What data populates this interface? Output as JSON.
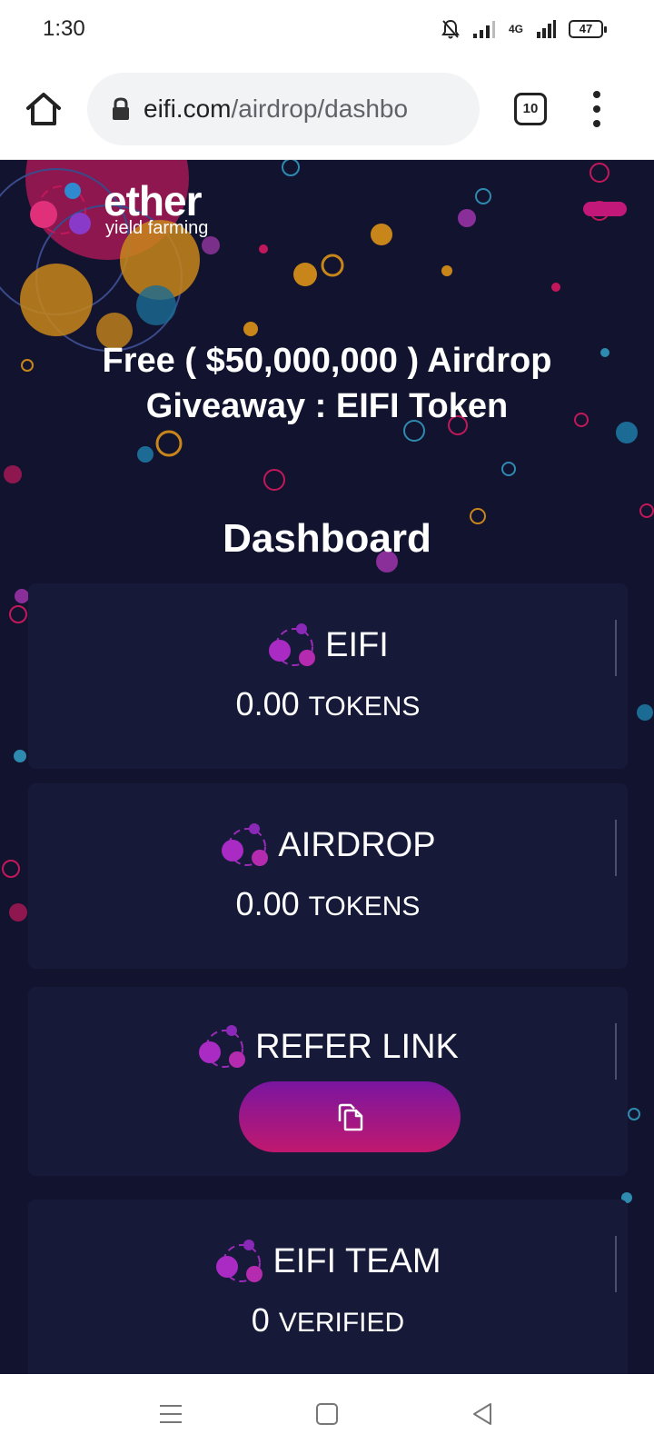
{
  "status_bar": {
    "time": "1:30",
    "network": "4G",
    "battery": "47"
  },
  "browser": {
    "url_host": "eifi.com",
    "url_path": "/airdrop/dashbo",
    "tab_count": "10"
  },
  "page": {
    "logo_word": "ether",
    "logo_sub": "yield farming",
    "headline_line1": "Free ( $50,000,000 ) Airdrop",
    "headline_line2": "Giveaway : EIFI Token",
    "dashboard_title": "Dashboard",
    "cards": [
      {
        "label": "EIFI",
        "value": "0.00",
        "unit": "TOKENS"
      },
      {
        "label": "AIRDROP",
        "value": "0.00",
        "unit": "TOKENS"
      },
      {
        "label": "REFER LINK"
      },
      {
        "label": "EIFI TEAM",
        "value": "0",
        "unit": "VERIFIED"
      }
    ],
    "colors": {
      "background": "#12142f",
      "card": "#161a38",
      "accent_pink": "#c0186e",
      "accent_purple": "#7a16a0"
    }
  },
  "icons": {
    "home": "home-icon",
    "lock": "lock-icon",
    "tabs": "tabs-icon",
    "menu": "more-vert-icon",
    "copy": "copy-icon",
    "nav_recents": "recents-icon",
    "nav_home": "nav-home-icon",
    "nav_back": "back-icon"
  }
}
